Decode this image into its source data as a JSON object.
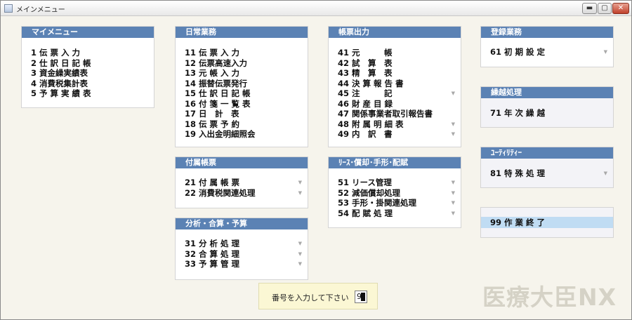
{
  "window": {
    "title": "メインメニュー",
    "btn_min": "▬",
    "btn_max": "▢",
    "btn_close": "✕"
  },
  "panels": {
    "my_menu": {
      "title": "マイメニュー",
      "items": [
        {
          "label": "1 伝 票 入 力"
        },
        {
          "label": "2 仕 訳 日 記 帳"
        },
        {
          "label": "3 資金繰実績表"
        },
        {
          "label": "4 消費税集計表"
        },
        {
          "label": "5 予 算 実 績 表"
        }
      ]
    },
    "daily": {
      "title": "日常業務",
      "items": [
        {
          "label": "11 伝 票 入 力"
        },
        {
          "label": "12 伝票高速入力"
        },
        {
          "label": "13 元 帳 入 力"
        },
        {
          "label": "14 振替伝票発行"
        },
        {
          "label": "15 仕 訳 日 記 帳"
        },
        {
          "label": "16 付 箋 一 覧 表"
        },
        {
          "label": "17 日　計　表"
        },
        {
          "label": "18 伝 票 予 約"
        },
        {
          "label": "19 入出金明細照会"
        }
      ]
    },
    "attached": {
      "title": "付属帳票",
      "items": [
        {
          "label": "21 付 属 帳 票",
          "arrow": "▼"
        },
        {
          "label": "22 消費税関連処理",
          "arrow": "▼"
        }
      ]
    },
    "analysis": {
      "title": "分析・合算・予算",
      "items": [
        {
          "label": "31 分 析 処 理",
          "arrow": "▼"
        },
        {
          "label": "32 合 算 処 理",
          "arrow": "▼"
        },
        {
          "label": "33 予 算 管 理",
          "arrow": "▼"
        }
      ]
    },
    "reports": {
      "title": "帳票出力",
      "items": [
        {
          "label": "41 元　　　帳"
        },
        {
          "label": "42 試　算　表"
        },
        {
          "label": "43 精　算　表"
        },
        {
          "label": "44 決 算 報 告 書"
        },
        {
          "label": "45 注　　　記",
          "arrow": "▼"
        },
        {
          "label": "46 財 産 目 録"
        },
        {
          "label": "47 関係事業者取引報告書"
        },
        {
          "label": "48 附 属 明 細 表",
          "arrow": "▼"
        },
        {
          "label": "49 内　訳　書",
          "arrow": "▼"
        }
      ]
    },
    "lease": {
      "title": "ﾘｰｽ･償却･手形･配賦",
      "items": [
        {
          "label": "51 リース管理",
          "arrow": "▼"
        },
        {
          "label": "52 減価償却処理",
          "arrow": "▼"
        },
        {
          "label": "53 手形・掛関連処理",
          "arrow": "▼"
        },
        {
          "label": "54 配 賦 処 理",
          "arrow": "▼"
        }
      ]
    },
    "registration": {
      "title": "登録業務",
      "items": [
        {
          "label": "61 初 期 設 定",
          "arrow": "▼"
        }
      ]
    },
    "carryover": {
      "title": "繰越処理",
      "items": [
        {
          "label": "71 年 次 繰 越"
        }
      ]
    },
    "utility": {
      "title": "ﾕｰﾃｨﾘﾃｨｰ",
      "items": [
        {
          "label": "81 特 殊 処 理",
          "arrow": "▼"
        }
      ]
    },
    "exit": {
      "items": [
        {
          "label": "99 作 業 終 了"
        }
      ]
    }
  },
  "prompt": {
    "label": "番号を入力して下さい",
    "value": "9"
  },
  "logo": {
    "text": "医療大臣NX"
  },
  "colors": {
    "header": "#5b82b4",
    "selected": "#c0dcf3",
    "prompt_bg": "#fbf7d4",
    "window_bg": "#f6f4ec"
  }
}
